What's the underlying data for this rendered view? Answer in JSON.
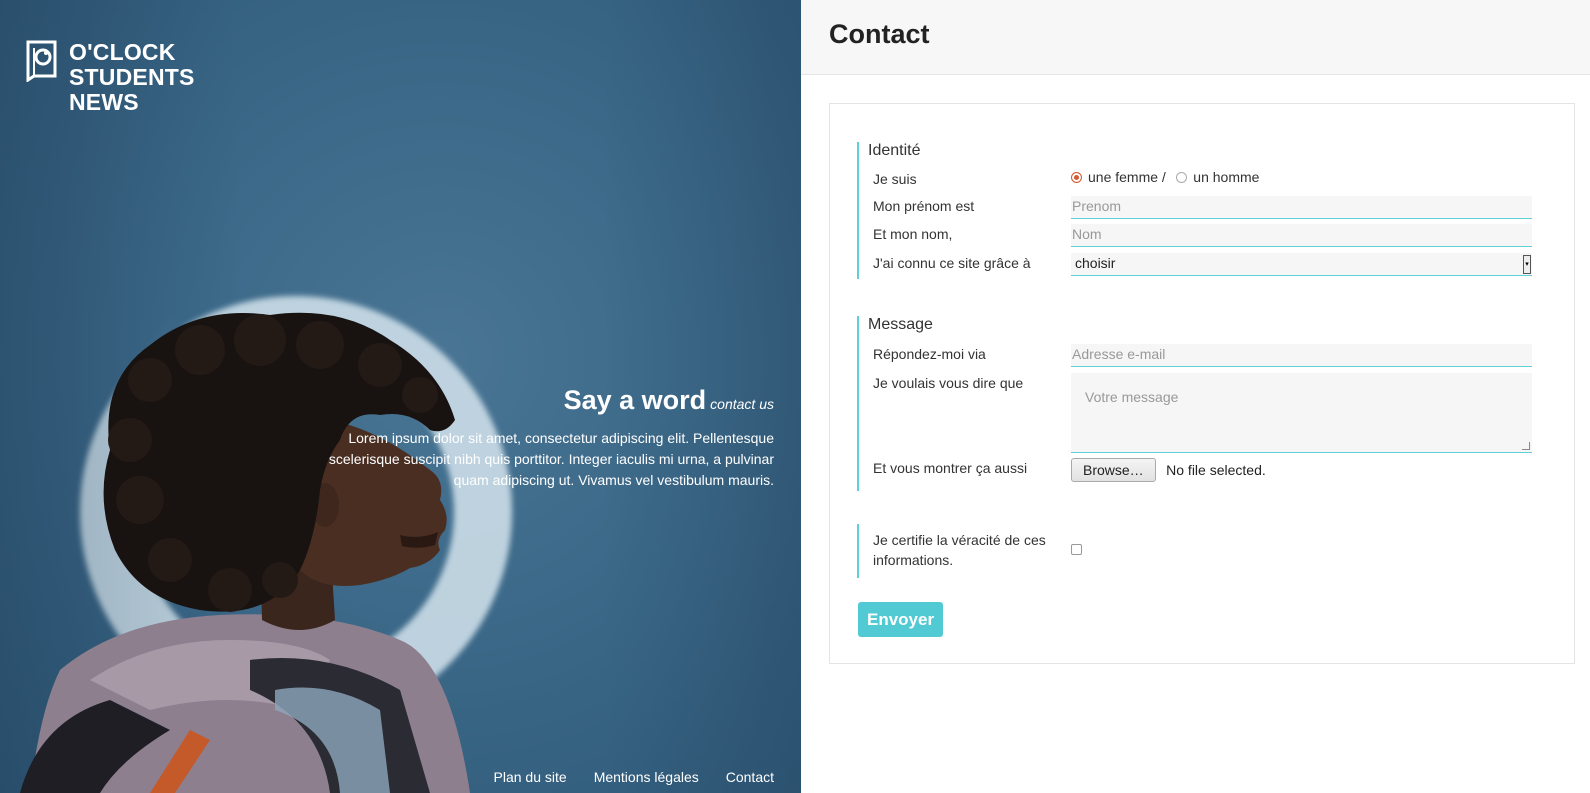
{
  "brand": {
    "name_line1": "O'CLOCK",
    "name_line2": "STUDENTS",
    "name_line3": "NEWS"
  },
  "hero": {
    "title": "Say a word",
    "subtitle": "contact us",
    "body": "Lorem ipsum dolor sit amet, consectetur adipiscing elit. Pellentesque scelerisque suscipit nibh quis porttitor. Integer iaculis mi urna, a pulvinar quam adipiscing ut. Vivamus vel vestibulum mauris."
  },
  "footer": {
    "links": [
      "Plan du site",
      "Mentions légales",
      "Contact"
    ]
  },
  "page": {
    "title": "Contact"
  },
  "form": {
    "identity": {
      "legend": "Identité",
      "gender_label": "Je suis",
      "gender_female": "une femme /",
      "gender_male": "un homme",
      "gender_selected": "une femme",
      "firstname_label": "Mon prénom est",
      "firstname_placeholder": "Prenom",
      "lastname_label": "Et mon nom,",
      "lastname_placeholder": "Nom",
      "source_label": "J'ai connu ce site grâce à",
      "source_value": "choisir"
    },
    "message": {
      "legend": "Message",
      "email_label": "Répondez-moi via",
      "email_placeholder": "Adresse e-mail",
      "message_label": "Je voulais vous dire que",
      "message_placeholder": "Votre message",
      "file_label": "Et vous montrer ça aussi",
      "file_button": "Browse…",
      "file_status": "No file selected."
    },
    "certify": {
      "label": "Je certifie la véracité de ces informations.",
      "checked": false
    },
    "submit_label": "Envoyer"
  },
  "colors": {
    "accent": "#52cad3",
    "radio_selected": "#d35b30",
    "hero_bg": "#3d6a8a"
  }
}
